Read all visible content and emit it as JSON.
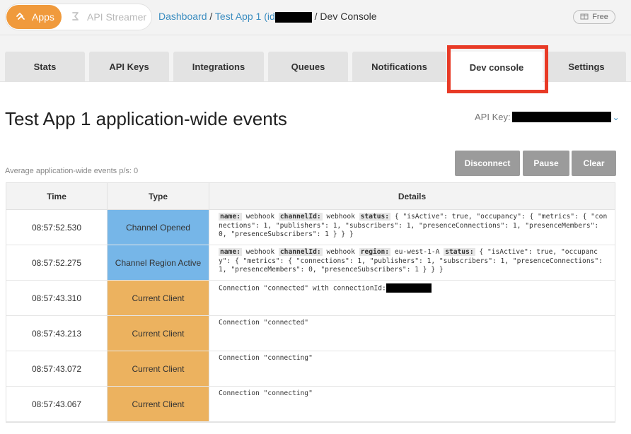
{
  "topbar": {
    "apps_label": "Apps",
    "streamer_label": "API Streamer",
    "breadcrumb": {
      "dashboard": "Dashboard",
      "separator": "/",
      "app_prefix": "Test App 1 (id",
      "current": "Dev Console"
    },
    "free_badge": "Free"
  },
  "tabs": [
    {
      "label": "Stats"
    },
    {
      "label": "API Keys"
    },
    {
      "label": "Integrations"
    },
    {
      "label": "Queues"
    },
    {
      "label": "Notifications"
    },
    {
      "label": "Dev console",
      "active": true
    },
    {
      "label": "Settings"
    }
  ],
  "heading": {
    "title": "Test App 1 application-wide events",
    "api_key_label": "API Key:"
  },
  "controls": {
    "disconnect": "Disconnect",
    "pause": "Pause",
    "clear": "Clear"
  },
  "rate_text": "Average application-wide events p/s: 0",
  "table": {
    "headers": {
      "time": "Time",
      "type": "Type",
      "details": "Details"
    },
    "rows": [
      {
        "time": "08:57:52.530",
        "type": "Channel Opened",
        "color": "#76b6e8",
        "details": {
          "k1": "name:",
          "v1": "webhook",
          "k2": "channelId:",
          "v2": "webhook",
          "k3": "status:",
          "v3": "{ \"isActive\": true, \"occupancy\": { \"metrics\": { \"connections\": 1, \"publishers\": 1, \"subscribers\": 1, \"presenceConnections\": 1, \"presenceMembers\": 0, \"presenceSubscribers\": 1 } } }"
        }
      },
      {
        "time": "08:57:52.275",
        "type": "Channel Region Active",
        "color": "#76b6e8",
        "details": {
          "k1": "name:",
          "v1": "webhook",
          "k2": "channelId:",
          "v2": "webhook",
          "k3": "region:",
          "v3": "eu-west-1-A",
          "k4": "status:",
          "v4": "{ \"isActive\": true, \"occupancy\": { \"metrics\": { \"connections\": 1, \"publishers\": 1, \"subscribers\": 1, \"presenceConnections\": 1, \"presenceMembers\": 0, \"presenceSubscribers\": 1 } } }"
        }
      },
      {
        "time": "08:57:43.310",
        "type": "Current Client",
        "color": "#ecb25f",
        "details": {
          "text": "Connection \"connected\" with connectionId:"
        }
      },
      {
        "time": "08:57:43.213",
        "type": "Current Client",
        "color": "#ecb25f",
        "details": {
          "text": "Connection \"connected\""
        }
      },
      {
        "time": "08:57:43.072",
        "type": "Current Client",
        "color": "#ecb25f",
        "details": {
          "text": "Connection \"connecting\""
        }
      },
      {
        "time": "08:57:43.067",
        "type": "Current Client",
        "color": "#ecb25f",
        "details": {
          "text": "Connection \"connecting\""
        }
      }
    ]
  },
  "colors": {
    "accent_orange": "#f09a3c",
    "link_blue": "#3b8dc0",
    "highlight_red": "#e83a26"
  },
  "icons": {
    "apps": "apps-icon",
    "streamer": "streamer-icon",
    "free": "gift-icon",
    "api_key_dropdown": "chevron-down-icon"
  }
}
